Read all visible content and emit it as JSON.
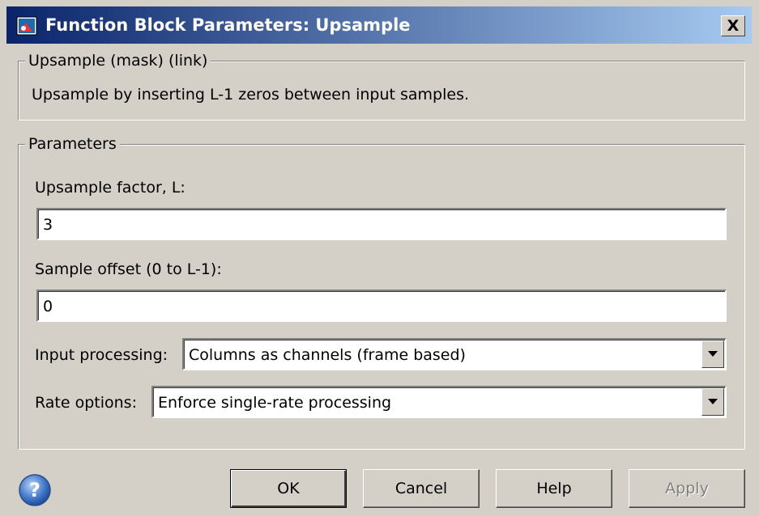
{
  "window": {
    "title": "Function Block Parameters: Upsample",
    "close_label": "X"
  },
  "description": {
    "legend": "Upsample (mask) (link)",
    "text": "Upsample by inserting L-1 zeros between input samples."
  },
  "parameters": {
    "legend": "Parameters",
    "factor_label": "Upsample factor, L:",
    "factor_value": "3",
    "offset_label": "Sample offset (0 to L-1):",
    "offset_value": "0",
    "input_processing_label": "Input processing:",
    "input_processing_value": "Columns as channels (frame based)",
    "rate_options_label": "Rate options:",
    "rate_options_value": "Enforce single-rate processing"
  },
  "buttons": {
    "ok": "OK",
    "cancel": "Cancel",
    "help": "Help",
    "apply": "Apply"
  },
  "icons": {
    "window": "simulink-block-icon",
    "help": "question-mark-icon"
  },
  "colors": {
    "title_start": "#0a246a",
    "title_end": "#a6caf0",
    "face": "#d4d0c8"
  }
}
